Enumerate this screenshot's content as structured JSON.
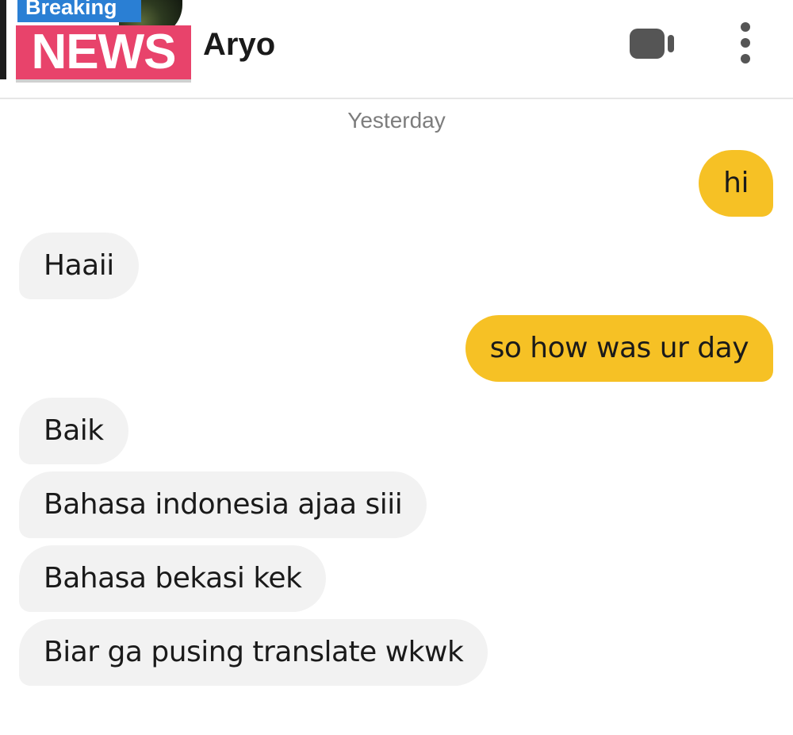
{
  "header": {
    "logo": {
      "top_text": "Breaking",
      "main_text": "NEWS"
    },
    "contact_name": "Aryo",
    "video_icon": "video-camera-icon",
    "more_icon": "more-vertical-icon"
  },
  "chat": {
    "date_separator": "Yesterday",
    "messages": [
      {
        "direction": "outgoing",
        "text": "hi"
      },
      {
        "direction": "incoming",
        "text": "Haaii"
      },
      {
        "direction": "outgoing",
        "text": "so how was ur day"
      },
      {
        "direction": "incoming",
        "text": "Baik"
      },
      {
        "direction": "incoming",
        "text": "Bahasa indonesia ajaa siii"
      },
      {
        "direction": "incoming",
        "text": "Bahasa bekasi kek"
      },
      {
        "direction": "incoming",
        "text": "Biar ga pusing translate wkwk"
      }
    ]
  },
  "colors": {
    "outgoing_bubble": "#f6c125",
    "incoming_bubble": "#f2f2f2",
    "logo_pink": "#e8436b",
    "logo_blue": "#2a7fd4",
    "icon_gray": "#555555"
  }
}
